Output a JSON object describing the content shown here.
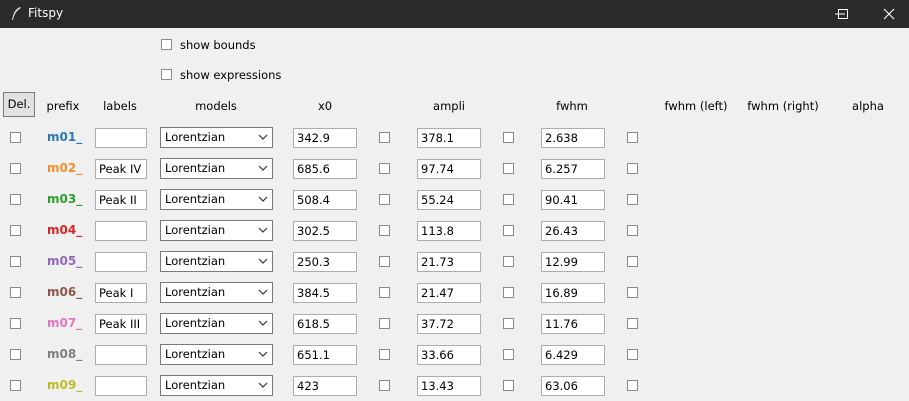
{
  "window": {
    "title": "Fitspy"
  },
  "options": {
    "show_bounds": "show bounds",
    "show_expressions": "show expressions"
  },
  "toolbar": {
    "del_label": "Del."
  },
  "columns": {
    "prefix": "prefix",
    "labels": "labels",
    "models": "models",
    "x0": "x0",
    "ampli": "ampli",
    "fwhm": "fwhm",
    "fwhm_left": "fwhm (left)",
    "fwhm_right": "fwhm (right)",
    "alpha": "alpha"
  },
  "rows": [
    {
      "prefix": "m01_",
      "color": "#2e75b6",
      "label": "",
      "model": "Lorentzian",
      "x0": "342.9",
      "ampli": "378.1",
      "fwhm": "2.638"
    },
    {
      "prefix": "m02_",
      "color": "#f28e2b",
      "label": "Peak IV",
      "model": "Lorentzian",
      "x0": "685.6",
      "ampli": "97.74",
      "fwhm": "6.257"
    },
    {
      "prefix": "m03_",
      "color": "#2ca02c",
      "label": "Peak II",
      "model": "Lorentzian",
      "x0": "508.4",
      "ampli": "55.24",
      "fwhm": "90.41"
    },
    {
      "prefix": "m04_",
      "color": "#d62728",
      "label": "",
      "model": "Lorentzian",
      "x0": "302.5",
      "ampli": "113.8",
      "fwhm": "26.43"
    },
    {
      "prefix": "m05_",
      "color": "#9467bd",
      "label": "",
      "model": "Lorentzian",
      "x0": "250.3",
      "ampli": "21.73",
      "fwhm": "12.99"
    },
    {
      "prefix": "m06_",
      "color": "#8c564b",
      "label": "Peak I",
      "model": "Lorentzian",
      "x0": "384.5",
      "ampli": "21.47",
      "fwhm": "16.89"
    },
    {
      "prefix": "m07_",
      "color": "#e377c2",
      "label": "Peak III",
      "model": "Lorentzian",
      "x0": "618.5",
      "ampli": "37.72",
      "fwhm": "11.76"
    },
    {
      "prefix": "m08_",
      "color": "#7f7f7f",
      "label": "",
      "model": "Lorentzian",
      "x0": "651.1",
      "ampli": "33.66",
      "fwhm": "6.429"
    },
    {
      "prefix": "m09_",
      "color": "#bcbd22",
      "label": "",
      "model": "Lorentzian",
      "x0": "423",
      "ampli": "13.43",
      "fwhm": "63.06"
    }
  ]
}
